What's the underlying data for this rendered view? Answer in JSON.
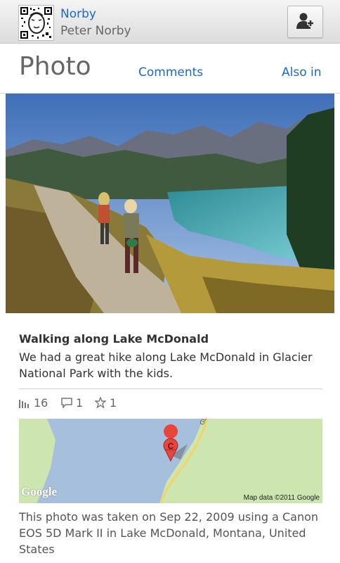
{
  "header": {
    "app_name": "Norby",
    "user_name": "Peter Norby",
    "avatar_icon": "qr-code-avatar",
    "add_contact_icon": "add-contact-icon"
  },
  "tabs": {
    "title": "Photo",
    "comments": "Comments",
    "also_in": "Also in"
  },
  "photo": {
    "title": "Walking along Lake McDonald",
    "description": "We had a great hike along Lake McDonald in Glacier National Park with the kids."
  },
  "stats": {
    "views": "16",
    "comments": "1",
    "stars": "1"
  },
  "map": {
    "logo": "Google",
    "credit": "Map data ©2011 Google",
    "road_label": "Glacier",
    "marker_letter": "C"
  },
  "info": {
    "text": "This photo was taken on Sep 22, 2009 using a Canon EOS 5D Mark II in  Lake McDonald, Montana, United States"
  },
  "colors": {
    "link": "#1a6ac4",
    "water": "#a5bfdd",
    "land": "#cde6b0",
    "marker": "#e8463c"
  }
}
